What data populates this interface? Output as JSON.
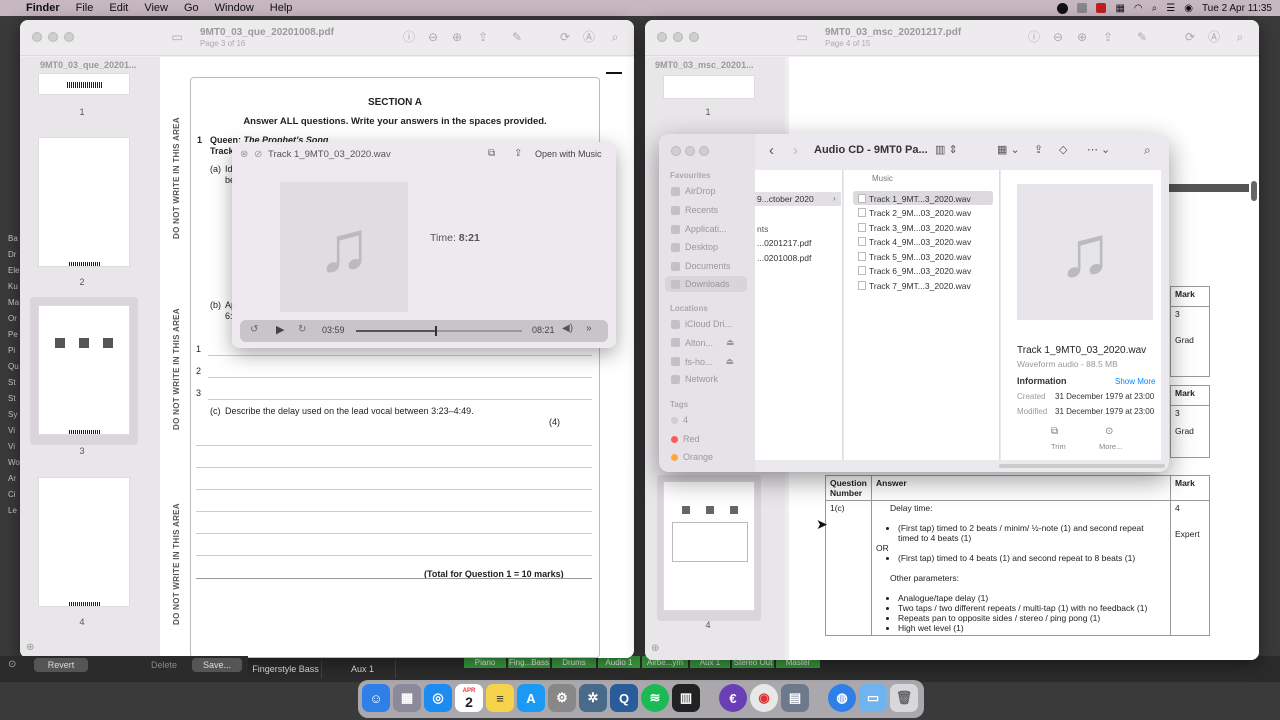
{
  "menubar": {
    "apple": "",
    "app": "Finder",
    "items": [
      "File",
      "Edit",
      "View",
      "Go",
      "Window",
      "Help"
    ],
    "clock": "Tue 2 Apr  11:35"
  },
  "left_doc": {
    "title": "9MT0_03_que_20201008.pdf",
    "subtitle": "Page 3 of 16",
    "sidebar_title": "9MT0_03_que_20201...",
    "thumb_numbers": [
      "1",
      "2",
      "3",
      "4"
    ],
    "section_heading": "SECTION A",
    "instruction": "Answer ALL questions. Write your answers in the spaces provided.",
    "q_number": "1",
    "q_title_prefix": "Queen: ",
    "q_title": "The Prophet’s Song",
    "q_track_prefix": "Track",
    "part_a": "(a)",
    "part_a_text": "Id",
    "part_a_text2": "be",
    "part_b": "(b)",
    "part_b_text": "Ap",
    "part_b_text2": "6:",
    "lines": [
      "1",
      "2",
      "3"
    ],
    "part_c": "(c)",
    "part_c_text": "Describe the delay used on the lead vocal between 3:23–4:49.",
    "part_c_marks": "(4)",
    "total": "(Total for Question 1 = 10 marks)",
    "margin_text": "DO NOT WRITE IN THIS AREA",
    "bottom_buttons": [
      "Revert",
      "Delete",
      "Save..."
    ]
  },
  "quicklook": {
    "title": "Track 1_9MT0_03_2020.wav",
    "open_with": "Open with Music",
    "time_label": "Time: ",
    "time_value": "8:21",
    "elapsed": "03:59",
    "total": "08:21",
    "progress": 0.48
  },
  "right_doc": {
    "title": "9MT0_03_msc_20201217.pdf",
    "subtitle": "Page 4 of 15",
    "sidebar_title": "9MT0_03_msc_20201...",
    "thumb_numbers": [
      "1",
      "4"
    ],
    "table_headers": [
      "Question Number",
      "Answer",
      "Mark"
    ],
    "question_number": "1(c)",
    "answer_heading": "Delay time:",
    "answer_bullets_1": [
      "(First tap) timed to 2 beats / minim/ ½-note (1) and second repeat timed to 4 beats (1)"
    ],
    "or_label": "OR",
    "answer_bullets_2": [
      "(First tap) timed to 4 beats (1) and second repeat to 8 beats (1)"
    ],
    "other_heading": "Other parameters:",
    "other_bullets": [
      "Analogue/tape delay (1)",
      "Two taps / two different repeats / multi-tap (1) with no feedback (1)",
      "Repeats pan to opposite sides / stereo / ping pong (1)",
      "High wet level (1)"
    ],
    "mark_value": "4",
    "mark_level": "Expert",
    "partial_mark_headers": [
      "Mark",
      "Mark"
    ],
    "partial_mark_values": [
      "3",
      "3"
    ],
    "partial_mark_levels": [
      "Grad",
      "Grad"
    ]
  },
  "finder": {
    "title": "Audio CD - 9MT0 Pa...",
    "sidebar": {
      "favourites_label": "Favourites",
      "favourites": [
        "AirDrop",
        "Recents",
        "Applicati...",
        "Desktop",
        "Documents",
        "Downloads"
      ],
      "locations_label": "Locations",
      "locations": [
        "iCloud Dri...",
        "Alton...",
        "fs-ho...",
        "Network"
      ],
      "tags_label": "Tags",
      "tags": [
        {
          "name": "4",
          "color": "#cfcfcf"
        },
        {
          "name": "Red",
          "color": "#ff5b57"
        },
        {
          "name": "Orange",
          "color": "#ffa63d"
        }
      ]
    },
    "column1": [
      "9...ctober 2020",
      "nts",
      "...0201217.pdf",
      "...0201008.pdf"
    ],
    "column2_header": "Music",
    "files": [
      "Track 1_9MT...3_2020.wav",
      "Track 2_9M...03_2020.wav",
      "Track 3_9M...03_2020.wav",
      "Track 4_9M...03_2020.wav",
      "Track 5_9M...03_2020.wav",
      "Track 6_9M...03_2020.wav",
      "Track 7_9MT...3_2020.wav"
    ],
    "preview": {
      "name": "Track 1_9MT0_03_2020.wav",
      "kind": "Waveform audio - 88.5 MB",
      "info_label": "Information",
      "show_more": "Show More",
      "created_label": "Created",
      "created": "31 December 1979 at 23:00",
      "modified_label": "Modified",
      "modified": "31 December 1979 at 23:00",
      "trim": "Trim",
      "more": "More..."
    }
  },
  "daw": {
    "tabs": [
      "Fingerstyle Bass",
      "Aux 1"
    ],
    "clips": [
      "Piano",
      "Fing...Bass",
      "Drums",
      "Audio 1",
      "Airbe...ym",
      "Aux 1",
      "Stereo Out",
      "Master"
    ]
  },
  "left_edge_labels": [
    "Ba",
    "Dr",
    "Ele",
    "Ku",
    "Ma",
    "Or",
    "Pe",
    "Pi",
    "Qu",
    "St",
    "St",
    "Sy",
    "Vi",
    "Vi",
    "Wo",
    "Ar",
    "Ci",
    "Le"
  ],
  "dock": {
    "calendar_month": "APR",
    "calendar_day": "2"
  },
  "colors": {
    "accent": "#0a84ff",
    "spotify": "#1db954",
    "daw_green": "#3a9a3e",
    "menubar": "#c7b7c0"
  }
}
